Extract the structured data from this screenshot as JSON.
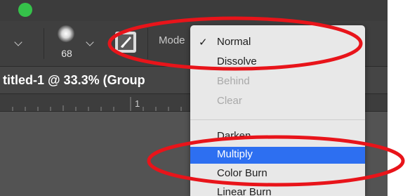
{
  "options_bar": {
    "brush_size": "68",
    "mode_label": "Mode",
    "icons": [
      "chevron-down-icon",
      "brush-preset-icon",
      "brush-settings-icon"
    ]
  },
  "document": {
    "tab_title": "titled-1 @ 33.3% (Group"
  },
  "ruler": {
    "visible_number": "1"
  },
  "blend_mode_menu": {
    "items": [
      {
        "label": "Normal",
        "checked": true,
        "enabled": true
      },
      {
        "label": "Dissolve",
        "enabled": true
      },
      {
        "label": "Behind",
        "enabled": false
      },
      {
        "label": "Clear",
        "enabled": false
      },
      {
        "label": "Darken",
        "enabled": true
      },
      {
        "label": "Multiply",
        "enabled": true,
        "highlighted": true
      },
      {
        "label": "Color Burn",
        "enabled": true
      },
      {
        "label": "Linear Burn",
        "enabled": true
      }
    ],
    "check_mark": "✓"
  },
  "colors": {
    "annotation_red": "#e8141a",
    "highlight_blue": "#2d6ff1",
    "window_green": "#35c24a"
  }
}
